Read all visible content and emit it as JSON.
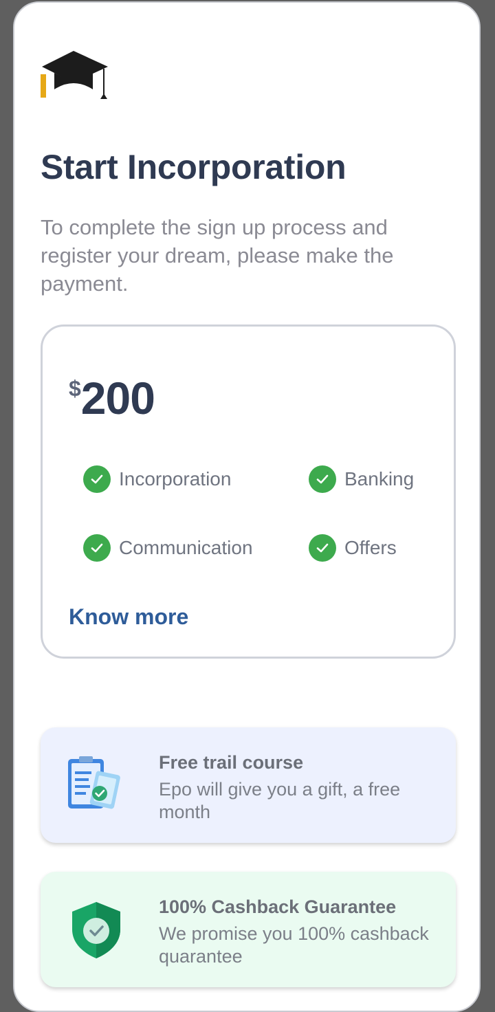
{
  "screen": {
    "title": "Start Incorporation",
    "subtitle": "To complete the sign up process and register your dream, please make the payment."
  },
  "pricing": {
    "currency": "$",
    "amount": "200",
    "features": [
      "Incorporation",
      "Banking",
      "Communication",
      "Offers"
    ],
    "know_more": "Know more"
  },
  "promos": [
    {
      "title": "Free trail course",
      "description": "Epo will give you a gift, a free month",
      "icon": "clipboard-check-icon",
      "background": "#edf1fe"
    },
    {
      "title": "100% Cashback Guarantee",
      "description": "We promise you 100% cashback quarantee",
      "icon": "shield-check-icon",
      "background": "#eafbf1"
    }
  ],
  "colors": {
    "heading": "#2f3a52",
    "link": "#2e5c99",
    "check": "#3daa4d"
  }
}
